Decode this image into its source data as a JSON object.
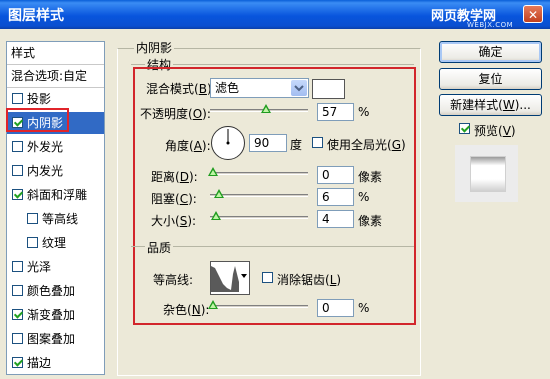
{
  "window": {
    "title": "图层样式",
    "watermark": "网页教学网",
    "watermark_sub": "WEBJX.COM",
    "close_symbol": "✕"
  },
  "styles_panel": {
    "header": "样式",
    "blend_options": "混合选项:自定",
    "items": [
      {
        "label": "投影",
        "checked": false,
        "selected": false
      },
      {
        "label": "内阴影",
        "checked": true,
        "selected": true
      },
      {
        "label": "外发光",
        "checked": false,
        "selected": false
      },
      {
        "label": "内发光",
        "checked": false,
        "selected": false
      },
      {
        "label": "斜面和浮雕",
        "checked": true,
        "selected": false
      },
      {
        "label": "等高线",
        "checked": false,
        "selected": false
      },
      {
        "label": "纹理",
        "checked": false,
        "selected": false
      },
      {
        "label": "光泽",
        "checked": false,
        "selected": false
      },
      {
        "label": "颜色叠加",
        "checked": false,
        "selected": false
      },
      {
        "label": "渐变叠加",
        "checked": true,
        "selected": false
      },
      {
        "label": "图案叠加",
        "checked": false,
        "selected": false
      },
      {
        "label": "描边",
        "checked": true,
        "selected": false
      }
    ]
  },
  "inner_shadow": {
    "group_title": "内阴影",
    "structure": {
      "title": "结构",
      "blend_mode_label": "混合模式",
      "blend_mode_key": "B",
      "blend_mode_value": "滤色",
      "color_swatch": "#ffffff",
      "opacity_label": "不透明度",
      "opacity_key": "O",
      "opacity_value": "57",
      "opacity_unit": "%",
      "opacity_level": 0.57,
      "angle_label": "角度",
      "angle_key": "A",
      "angle_value": "90",
      "angle_unit": "度",
      "global_light_label": "使用全局光",
      "global_light_key": "G",
      "global_light_checked": false,
      "distance_label": "距离",
      "distance_key": "D",
      "distance_value": "0",
      "distance_unit": "像素",
      "choke_label": "阻塞",
      "choke_key": "C",
      "choke_value": "6",
      "choke_unit": "%",
      "size_label": "大小",
      "size_key": "S",
      "size_value": "4",
      "size_unit": "像素"
    },
    "quality": {
      "title": "品质",
      "contour_label": "等高线",
      "antialias_label": "消除锯齿",
      "antialias_key": "L",
      "antialias_checked": false,
      "noise_label": "杂色",
      "noise_key": "N",
      "noise_value": "0",
      "noise_unit": "%"
    }
  },
  "buttons": {
    "ok": "确定",
    "reset": "复位",
    "new_style": "新建样式",
    "new_style_key": "W",
    "new_style_ellipsis": "...",
    "preview_label": "预览",
    "preview_key": "V",
    "preview_checked": true
  },
  "colors": {
    "selection": "#316ac5",
    "checkmark": "#21a121",
    "highlight_box": "#e0242a",
    "titlebar": "#0a5fd8"
  }
}
